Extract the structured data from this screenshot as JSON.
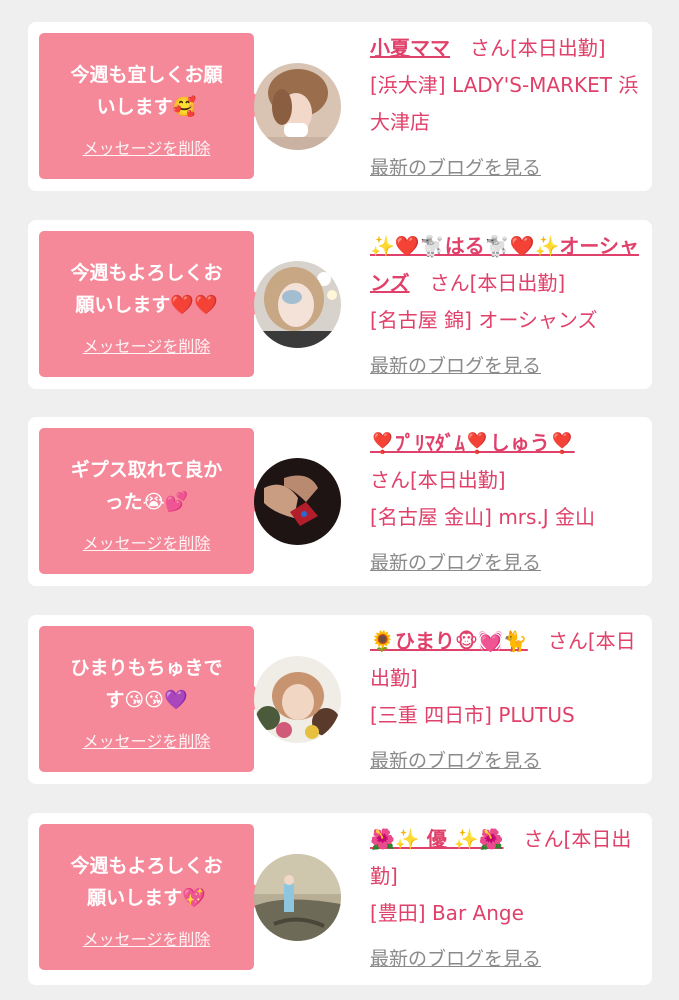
{
  "delete_label": "メッセージを削除",
  "blog_label": "最新のブログを見る",
  "colors": {
    "background": "#efefef",
    "bubble": "#f5899a",
    "accent_text": "#e0416a",
    "link_gray": "#8a8a8a"
  },
  "cards": [
    {
      "message": "今週も宜しくお願\nいします🥰",
      "name": "小夏ママ",
      "suffix": "　さん[本日出勤]",
      "shop": "[浜大津] LADY'S-MARKET 浜大津店",
      "avatar_icon": "woman-portrait-avatar-icon"
    },
    {
      "message": "今週もよろしくお\n願いします❤️❤️",
      "name": "✨❤️🐩はる🐩❤️✨オーシャンズ",
      "suffix": "　さん[本日出勤]",
      "shop": "[名古屋 錦] オーシャンズ",
      "avatar_icon": "woman-selfie-avatar-icon"
    },
    {
      "message": "ギプス取れて良か\nった😭💕",
      "name": "❣️ﾌﾟﾘﾏﾀﾞﾑ❣️しゅう❣️",
      "suffix": " さん[本日出勤]",
      "shop": "[名古屋 金山] mrs.J 金山",
      "avatar_icon": "legs-dark-avatar-icon"
    },
    {
      "message": "ひまりもちゅきで\nす😘😘💜",
      "name": "🌻ひまり🐵💓🐈",
      "suffix": "　さん[本日出勤]",
      "shop": "[三重 四日市] PLUTUS",
      "avatar_icon": "woman-flowers-avatar-icon"
    },
    {
      "message": "今週もよろしくお\n願いします💖",
      "name": "🌺✨ 優 ✨🌺",
      "suffix": "　さん[本日出勤]",
      "shop": "[豊田] Bar Ange",
      "avatar_icon": "outdoor-person-avatar-icon"
    }
  ]
}
